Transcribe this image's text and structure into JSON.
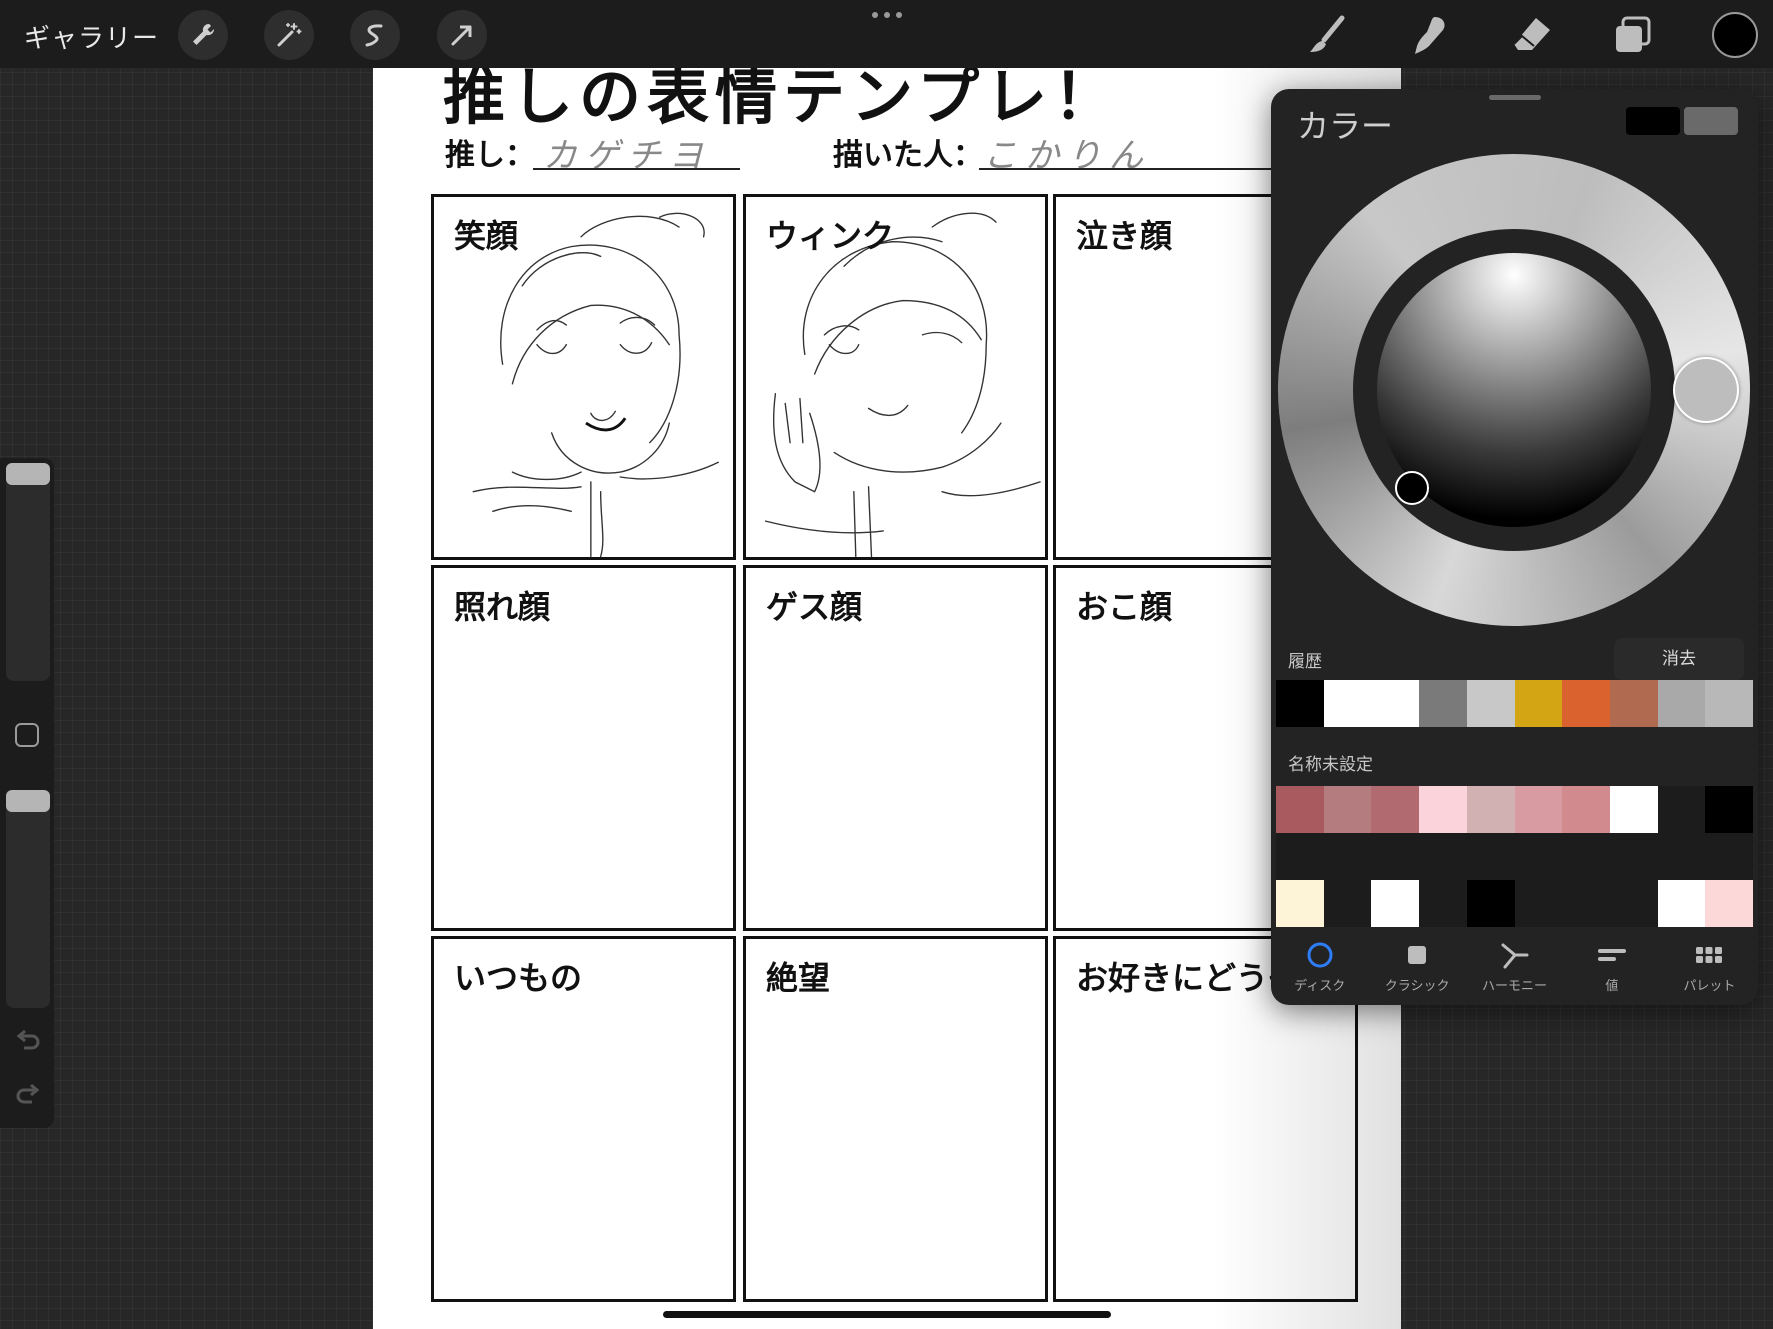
{
  "topbar": {
    "gallery": "ギャラリー",
    "tools_left": [
      "wrench-icon",
      "magic-wand-icon",
      "selection-icon",
      "transform-arrow-icon"
    ],
    "tools_right": [
      "brush-icon",
      "smudge-icon",
      "eraser-icon",
      "layers-icon"
    ],
    "current_color": "#000000"
  },
  "canvas": {
    "title": "推しの表情テンプレ！",
    "oshi_label": "推し：",
    "oshi_value": "カゲチヨ",
    "author_label": "描いた人：",
    "author_value": "こかりん",
    "cells": [
      {
        "label": "笑顔"
      },
      {
        "label": "ウィンク"
      },
      {
        "label": "泣き顔"
      },
      {
        "label": "照れ顔"
      },
      {
        "label": "ゲス顔"
      },
      {
        "label": "おこ顔"
      },
      {
        "label": "いつもの"
      },
      {
        "label": "絶望"
      },
      {
        "label": "お好きにどうぞ"
      }
    ]
  },
  "color_panel": {
    "title": "カラー",
    "primary": "#000000",
    "secondary": "#6a6a6a",
    "history_label": "履歴",
    "clear_label": "消去",
    "history": [
      "#000000",
      "#ffffff",
      "#ffffff",
      "#7a7a7a",
      "#c8c8c8",
      "#d3a514",
      "#d9622e",
      "#b06a50",
      "#a9a9a9",
      "#b8b8b8"
    ],
    "palette_label": "名称未設定",
    "palette_row1": [
      "#a85a5e",
      "#b47c7e",
      "#b06a70",
      "#fbd3db",
      "#d2b1b3",
      "#d79ba1",
      "#d18b8f",
      "#ffffff",
      "#1c1c1c",
      "#000000"
    ],
    "palette_row2": [
      "#1c1c1c",
      "#1c1c1c",
      "#1c1c1c",
      "#1c1c1c",
      "#1c1c1c",
      "#1c1c1c",
      "#1c1c1c",
      "#1c1c1c",
      "#1c1c1c",
      "#1c1c1c"
    ],
    "palette_row3": [
      "#fdf3d6",
      "#1c1c1c",
      "#ffffff",
      "#1c1c1c",
      "#000000",
      "#1c1c1c",
      "#1c1c1c",
      "#1c1c1c",
      "#ffffff",
      "#fcd8d8"
    ],
    "tabs": [
      {
        "label": "ディスク",
        "icon": "disc-icon",
        "active": true
      },
      {
        "label": "クラシック",
        "icon": "classic-square-icon",
        "active": false
      },
      {
        "label": "ハーモニー",
        "icon": "harmony-icon",
        "active": false
      },
      {
        "label": "値",
        "icon": "value-sliders-icon",
        "active": false
      },
      {
        "label": "パレット",
        "icon": "palette-grid-icon",
        "active": false
      }
    ]
  }
}
